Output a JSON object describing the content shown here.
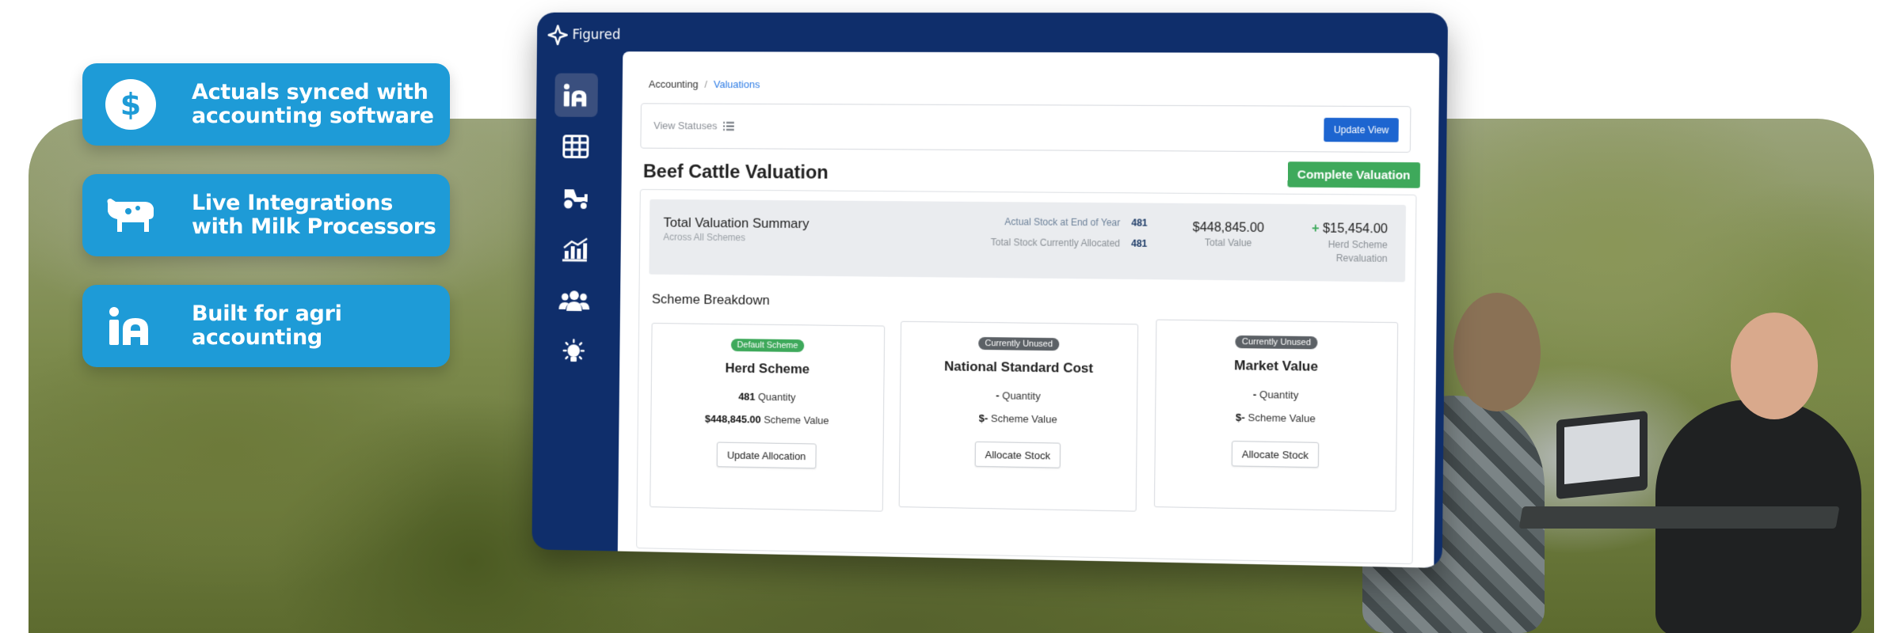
{
  "features": [
    {
      "icon": "dollar-circle-icon",
      "line1": "Actuals synced with",
      "line2": "accounting software"
    },
    {
      "icon": "cow-icon",
      "line1": "Live Integrations",
      "line2": "with Milk Processors"
    },
    {
      "icon": "figured-logo-icon",
      "line1": "Built for agri",
      "line2": "accounting"
    }
  ],
  "app": {
    "brand": "Figured",
    "sidebar": [
      {
        "icon": "figured-home-icon",
        "active": true
      },
      {
        "icon": "table-grid-icon",
        "active": false
      },
      {
        "icon": "tractor-icon",
        "active": false
      },
      {
        "icon": "bar-chart-icon",
        "active": false
      },
      {
        "icon": "users-icon",
        "active": false
      },
      {
        "icon": "lightbulb-icon",
        "active": false
      }
    ],
    "breadcrumb": {
      "parent": "Accounting",
      "separator": "/",
      "current": "Valuations"
    },
    "toolbar": {
      "view_statuses": "View Statuses",
      "update_view": "Update View"
    },
    "page_title": "Beef Cattle Valuation",
    "complete_button": "Complete Valuation",
    "summary": {
      "title": "Total Valuation Summary",
      "subtitle": "Across All Schemes",
      "actual_stock_label": "Actual Stock at End of Year",
      "actual_stock_value": "481",
      "allocated_label": "Total Stock Currently Allocated",
      "allocated_value": "481",
      "total_value": "$448,845.00",
      "total_value_label": "Total Value",
      "revaluation_sign": "+",
      "revaluation_value": "$15,454.00",
      "revaluation_label": "Herd Scheme Revaluation"
    },
    "breakdown_title": "Scheme Breakdown",
    "schemes": [
      {
        "badge": "Default Scheme",
        "name": "Herd Scheme",
        "quantity": "481",
        "quantity_label": "Quantity",
        "value": "$448,845.00",
        "value_label": "Scheme Value",
        "button": "Update Allocation"
      },
      {
        "badge": "Currently Unused",
        "name": "National Standard Cost",
        "quantity": "-",
        "quantity_label": "Quantity",
        "value": "$-",
        "value_label": "Scheme Value",
        "button": "Allocate Stock"
      },
      {
        "badge": "Currently Unused",
        "name": "Market Value",
        "quantity": "-",
        "quantity_label": "Quantity",
        "value": "$-",
        "value_label": "Scheme Value",
        "button": "Allocate Stock"
      }
    ]
  },
  "colors": {
    "feature_blue": "#1e9bd7",
    "window_navy": "#0f2e6b",
    "primary_button": "#1d65d0",
    "success_green": "#3ea95b",
    "link_blue": "#2c7be5"
  }
}
